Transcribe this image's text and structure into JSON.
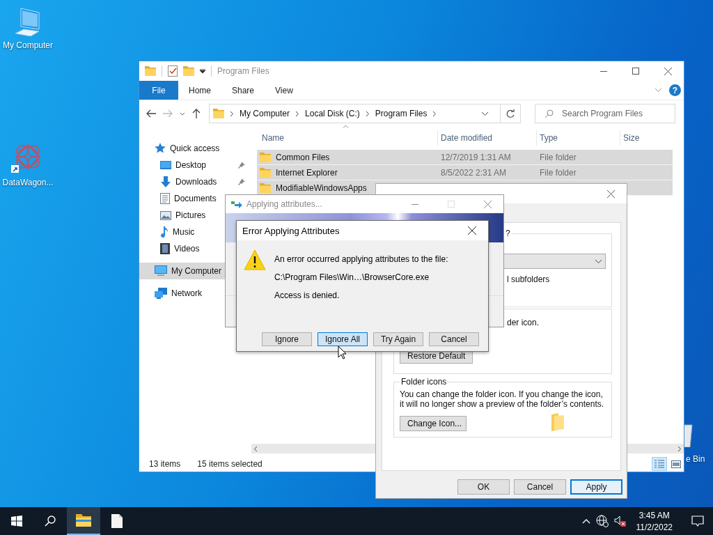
{
  "desktop_icons": [
    {
      "kind": "computer",
      "label": "My Computer"
    },
    {
      "kind": "shortcut",
      "label": "DataWagon..."
    },
    {
      "kind": "recycle",
      "label": "e Bin"
    }
  ],
  "explorer": {
    "title": "Program Files",
    "ribbon_tabs": [
      {
        "label": "File",
        "selected": true
      },
      {
        "label": "Home",
        "selected": false
      },
      {
        "label": "Share",
        "selected": false
      },
      {
        "label": "View",
        "selected": false
      }
    ],
    "help": "?",
    "breadcrumbs": [
      "My Computer",
      "Local Disk (C:)",
      "Program Files"
    ],
    "search": {
      "placeholder": "Search Program Files"
    },
    "nav": [
      {
        "kind": "star",
        "label": "Quick access",
        "selected": false,
        "children": [
          {
            "kind": "desktop",
            "label": "Desktop",
            "pinned": true,
            "selected": false
          },
          {
            "kind": "download",
            "label": "Downloads",
            "pinned": true,
            "selected": false
          },
          {
            "kind": "document",
            "label": "Documents",
            "selected": false
          },
          {
            "kind": "pictures",
            "label": "Pictures",
            "selected": false
          },
          {
            "kind": "music",
            "label": "Music",
            "pinned": false,
            "selected": false
          },
          {
            "kind": "videos",
            "label": "Videos",
            "pinned": false,
            "selected": false
          }
        ]
      },
      {
        "kind": "computer",
        "label": "My Computer",
        "selected": true
      },
      {
        "kind": "network",
        "label": "Network",
        "selected": false
      }
    ],
    "columns": [
      "Name",
      "Date modified",
      "Type",
      "Size"
    ],
    "rows": [
      {
        "name": "Common Files",
        "date": "12/7/2019 1:31 AM",
        "type": "File folder",
        "selected": true
      },
      {
        "name": "Internet Explorer",
        "date": "8/5/2022 2:31 AM",
        "type": "File folder",
        "selected": true
      },
      {
        "name": "ModifiableWindowsApps",
        "selected": true
      }
    ],
    "status": {
      "count": "13 items",
      "selection": "15 items selected"
    },
    "views": [
      {
        "kind": "details",
        "selected": true
      },
      {
        "kind": "large-icons",
        "selected": false
      }
    ]
  },
  "properties_window": {
    "template_group": {
      "label": "?",
      "subfolders": "l subfolders"
    },
    "pictures_group": {
      "text": "der icon.",
      "button": "Restore Default"
    },
    "folder_icons_group": {
      "label": "Folder icons",
      "text": "You can change the folder icon. If you change the icon, it will no longer show a preview of the folder’s contents.",
      "button": "Change Icon..."
    },
    "buttons": [
      {
        "label": "OK",
        "focused": false
      },
      {
        "label": "Cancel",
        "focused": false
      },
      {
        "label": "Apply",
        "focused": true
      }
    ]
  },
  "progress_window": {
    "title": "Applying attributes..."
  },
  "error_dialog": {
    "title": "Error Applying Attributes",
    "message": "An error occurred applying attributes to the file:",
    "path": "C:\\Program Files\\Win…\\BrowserCore.exe",
    "detail": "Access is denied.",
    "buttons": [
      {
        "label": "Ignore",
        "focused": false
      },
      {
        "label": "Ignore All",
        "focused": true
      },
      {
        "label": "Try Again",
        "focused": false
      },
      {
        "label": "Cancel",
        "focused": false
      }
    ]
  },
  "taskbar": {
    "apps": [
      {
        "kind": "explorer",
        "active": true
      },
      {
        "kind": "file",
        "active": false
      }
    ],
    "time": "3:45 AM",
    "date": "11/2/2022"
  }
}
